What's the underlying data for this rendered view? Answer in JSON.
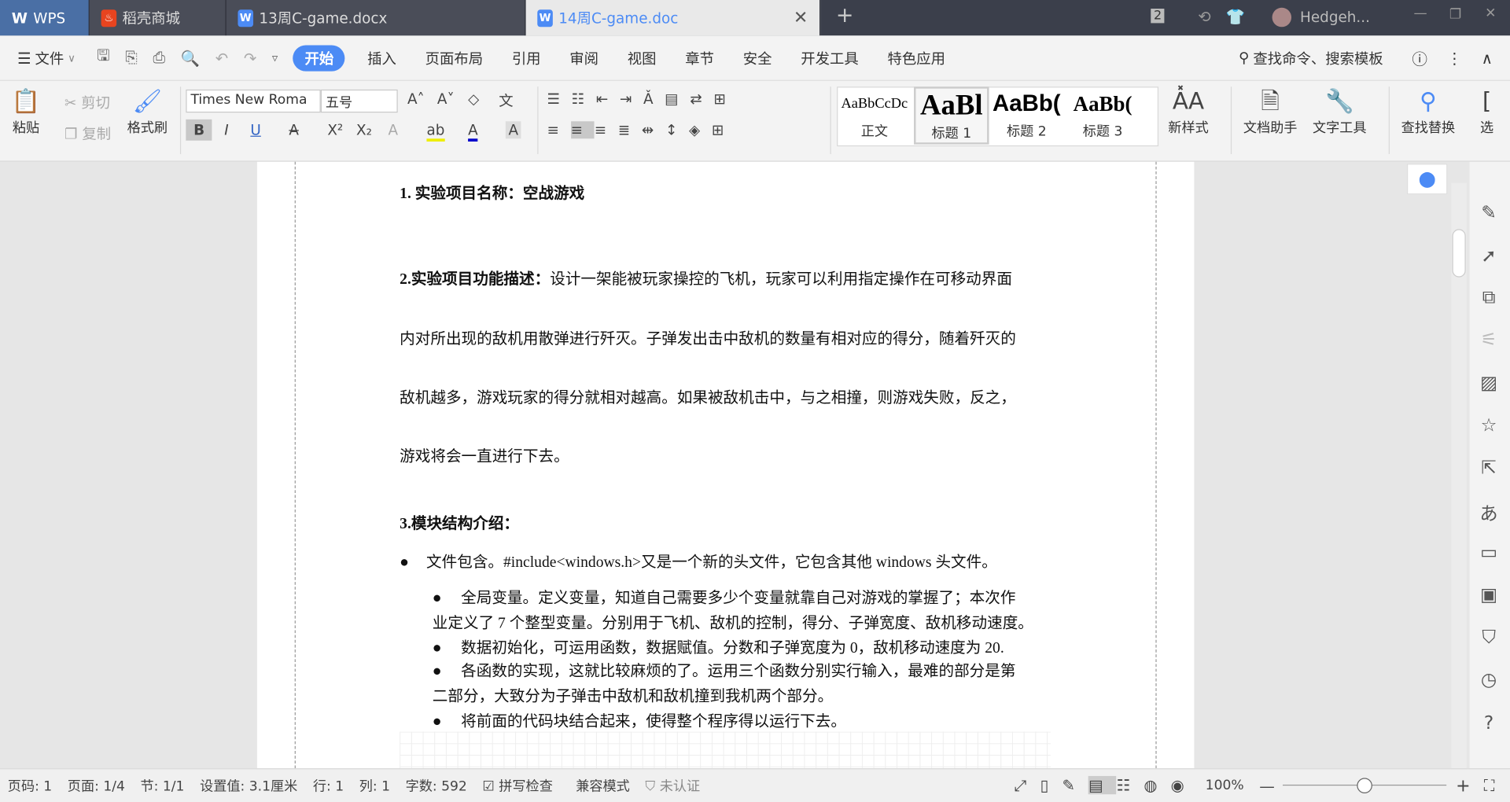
{
  "titlebar": {
    "tabs": [
      {
        "label": "WPS"
      },
      {
        "label": "稻壳商城"
      },
      {
        "label": "13周C-game.docx"
      },
      {
        "label": "14周C-game.doc"
      }
    ],
    "window_count": "2",
    "user": "Hedgeh..."
  },
  "menu": {
    "file": "文件",
    "items": [
      "开始",
      "插入",
      "页面布局",
      "引用",
      "审阅",
      "视图",
      "章节",
      "安全",
      "开发工具",
      "特色应用"
    ],
    "search": "查找命令、搜索模板"
  },
  "ribbon": {
    "paste": "粘贴",
    "cut": "剪切",
    "copy": "复制",
    "format_painter": "格式刷",
    "font": "Times New Roma",
    "size": "五号",
    "styles": [
      {
        "preview": "AaBbCcDc",
        "label": "正文"
      },
      {
        "preview": "AaBl",
        "label": "标题 1"
      },
      {
        "preview": "AaBb(",
        "label": "标题 2"
      },
      {
        "preview": "AaBb(",
        "label": "标题 3"
      }
    ],
    "new_style": "新样式",
    "doc_assistant": "文档助手",
    "text_tools": "文字工具",
    "find_replace": "查找替换",
    "select": "选"
  },
  "document": {
    "h1": "1.  实验项目名称：空战游戏",
    "h2_label": "2.实验项目功能描述：",
    "h2_lines": [
      "设计一架能被玩家操控的飞机，玩家可以利用指定操作在可移动界面",
      "内对所出现的敌机用散弹进行歼灭。子弹发出击中敌机的数量有相对应的得分，随着歼灭的",
      "敌机越多，游戏玩家的得分就相对越高。如果被敌机击中，与之相撞，则游戏失败，反之，",
      "游戏将会一直进行下去。"
    ],
    "h3": "3.模块结构介绍：",
    "bullet1": "文件包含。#include<windows.h>又是一个新的头文件，它包含其他 windows 头文件。",
    "sub": [
      [
        "全局变量。定义变量，知道自己需要多少个变量就靠自己对游戏的掌握了；本次作",
        "业定义了 7 个整型变量。分别用于飞机、敌机的控制，得分、子弹宽度、敌机移动速度。"
      ],
      [
        "数据初始化，可运用函数，数据赋值。分数和子弹宽度为 0，敌机移动速度为 20."
      ],
      [
        "各函数的实现，这就比较麻烦的了。运用三个函数分别实行输入，最难的部分是第",
        "二部分，大致分为子弹击中敌机和敌机撞到我机两个部分。"
      ],
      [
        "将前面的代码块结合起来，使得整个程序得以运行下去。"
      ]
    ]
  },
  "status": {
    "page_no": "页码: 1",
    "pages": "页面: 1/4",
    "section": "节: 1/1",
    "setting": "设置值: 3.1厘米",
    "row": "行: 1",
    "col": "列: 1",
    "words": "字数: 592",
    "spell": "拼写检查",
    "compat": "兼容模式",
    "cert": "未认证",
    "zoom": "100%",
    "zoom_fraction": 0.5
  }
}
